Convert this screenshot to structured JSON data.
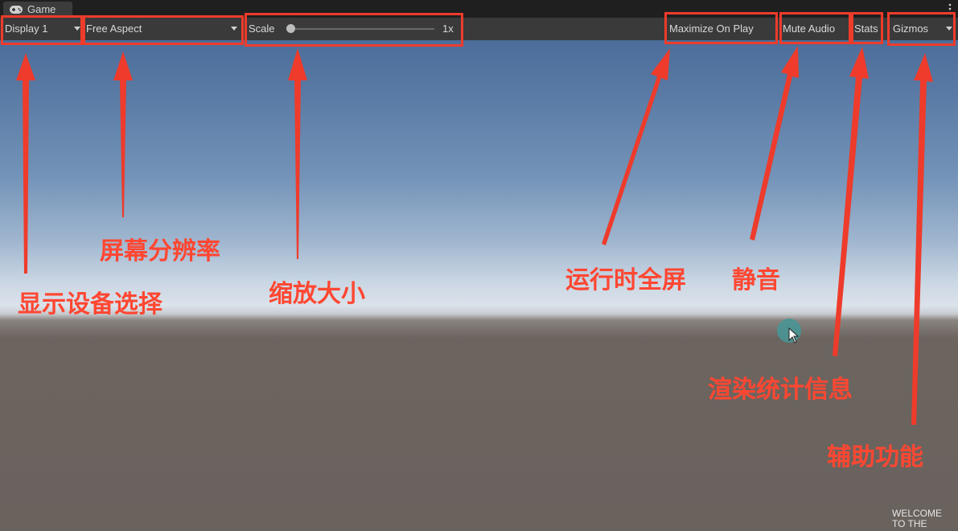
{
  "window": {
    "tab_title": "Game",
    "tab_icon": "gamepad-icon"
  },
  "toolbar": {
    "display": "Display 1",
    "aspect": "Free Aspect",
    "scale_label": "Scale",
    "scale_value": "1x",
    "scale_fraction": 0.0,
    "maximize": "Maximize On Play",
    "mute": "Mute Audio",
    "stats": "Stats",
    "gizmos": "Gizmos"
  },
  "annotations": {
    "display": "显示设备选择",
    "aspect": "屏幕分辨率",
    "scale": "缩放大小",
    "maximize": "运行时全屏",
    "mute": "静音",
    "stats": "渲染统计信息",
    "gizmos": "辅助功能"
  },
  "watermark": {
    "line1": "WELCOME",
    "line2": "TO THE"
  },
  "colors": {
    "annotation_red": "#ee3b2b",
    "toolbar_bg": "#3a3a3a",
    "sky_top": "#4c6d9a",
    "ground": "#6a625d"
  }
}
